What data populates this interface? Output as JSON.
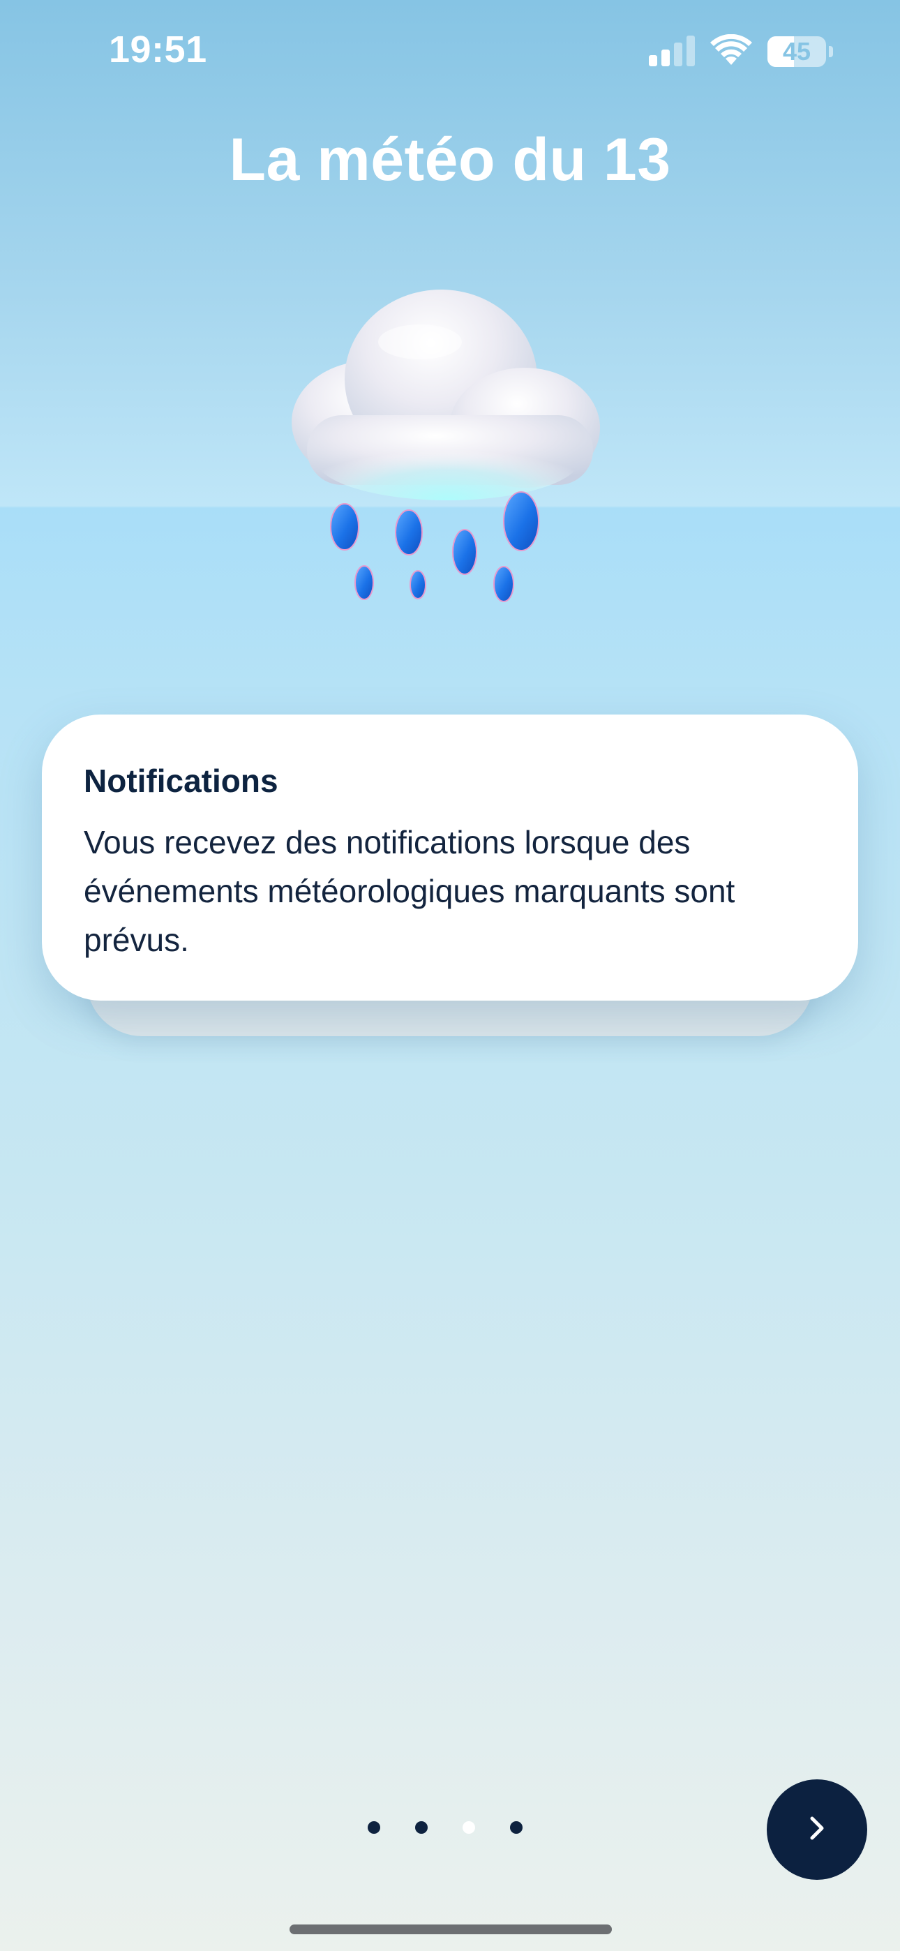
{
  "status_bar": {
    "time": "19:51",
    "battery": "45",
    "battery_level": 0.45,
    "signal_icon": "cellular-signal-icon",
    "wifi_icon": "wifi-icon"
  },
  "page": {
    "title": "La météo du 13",
    "illustration": "rain-cloud-icon"
  },
  "card": {
    "title": "Notifications",
    "body": "Vous recevez des notifications lorsque des événements météorologiques marquants sont prévus."
  },
  "pager": {
    "total": 4,
    "active_index": 2
  },
  "next_button": {
    "icon": "chevron-right-icon"
  },
  "colors": {
    "navy": "#0c2140",
    "card_bg": "#ffffff",
    "sky_top": "#86c4e4"
  }
}
